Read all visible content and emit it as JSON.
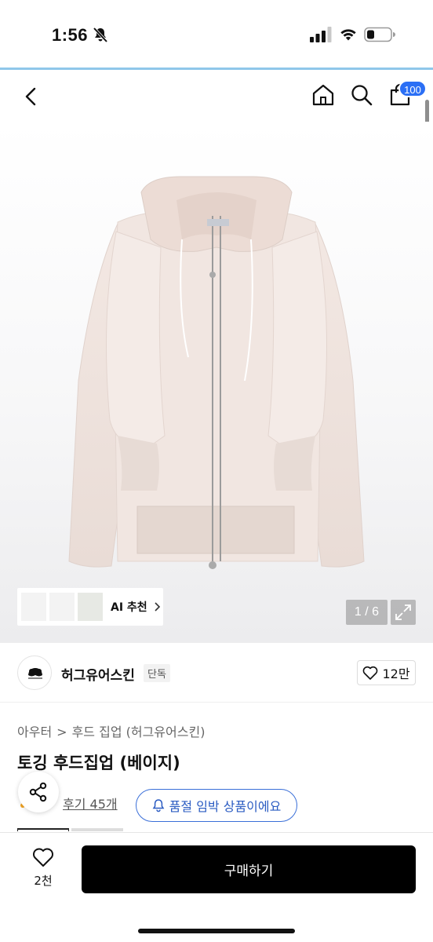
{
  "status_bar": {
    "time": "1:56",
    "icons": [
      "bell-off-icon",
      "signal-icon",
      "wifi-icon",
      "battery-icon"
    ]
  },
  "header": {
    "icons": [
      "back-icon",
      "home-icon",
      "search-icon",
      "cart-icon"
    ],
    "cart_badge": "100"
  },
  "gallery": {
    "counter": "1 / 6",
    "ai_recommend": {
      "label": "AI 추천",
      "thumbnail_count": 3
    }
  },
  "brand": {
    "name": "허그유어스킨",
    "tag": "단독",
    "likes": "12만"
  },
  "product": {
    "category": [
      "아우터",
      "후드 집업 (허그유어스킨)"
    ],
    "title": "토깅 후드집업 (베이지)",
    "reviews": "후기 45개",
    "alert": "품절 임박 상품이에요"
  },
  "bottom_bar": {
    "wish_count": "2천",
    "buy_label": "구매하기"
  },
  "colors": {
    "accent_blue": "#2b6ff5",
    "status_line": "#8fc7ea",
    "alert_blue": "#2a5bc2",
    "buy_button": "#000000",
    "hoodie_beige": "#efe1d9"
  }
}
